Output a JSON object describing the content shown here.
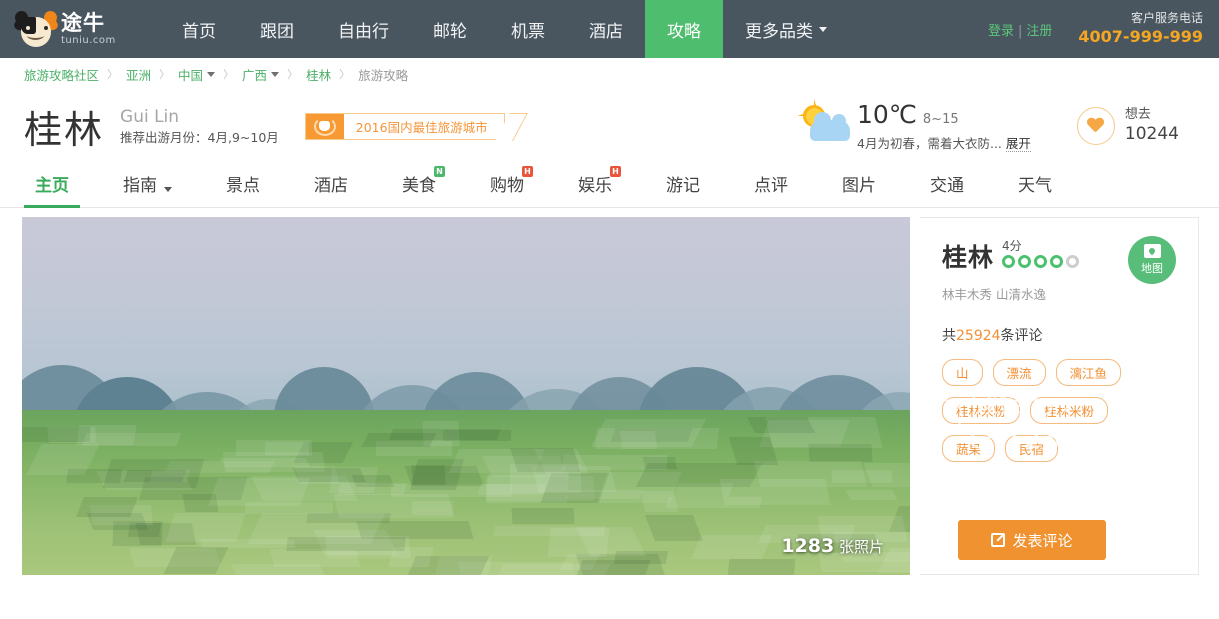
{
  "header": {
    "logo": {
      "cn": "途牛",
      "en": "tuniu.com",
      "icon": "cow-logo-icon"
    },
    "nav": [
      {
        "label": "首页",
        "active": false,
        "caret": false
      },
      {
        "label": "跟团",
        "active": false,
        "caret": false
      },
      {
        "label": "自由行",
        "active": false,
        "caret": false
      },
      {
        "label": "邮轮",
        "active": false,
        "caret": false
      },
      {
        "label": "机票",
        "active": false,
        "caret": false
      },
      {
        "label": "酒店",
        "active": false,
        "caret": false
      },
      {
        "label": "攻略",
        "active": true,
        "caret": false
      },
      {
        "label": "更多品类",
        "active": false,
        "caret": true
      }
    ],
    "login": "登录",
    "separator": "|",
    "register": "注册",
    "service_label": "客户服务电话",
    "service_phone": "4007-999-999"
  },
  "breadcrumb": {
    "items": [
      {
        "label": "旅游攻略社区",
        "caret": false,
        "current": false
      },
      {
        "label": "亚洲",
        "caret": false,
        "current": false
      },
      {
        "label": "中国",
        "caret": true,
        "current": false
      },
      {
        "label": "广西",
        "caret": true,
        "current": false
      },
      {
        "label": "桂林",
        "caret": false,
        "current": false
      },
      {
        "label": "旅游攻略",
        "caret": false,
        "current": true
      }
    ],
    "separator": "〉"
  },
  "city": {
    "name_cn": "桂林",
    "name_en": "Gui Lin",
    "best_months": "推荐出游月份：4月,9~10月",
    "award": "2016国内最佳旅游城市"
  },
  "weather": {
    "icon": "sun-cloud-icon",
    "temp": "10℃",
    "range": "8~15",
    "desc": "4月为初春，需着大衣防...",
    "expand": "展开"
  },
  "wish": {
    "icon": "heart-icon",
    "label": "想去",
    "count": "10244"
  },
  "tabs": [
    {
      "label": "主页",
      "active": true,
      "badge": "",
      "badge_type": "",
      "caret": false
    },
    {
      "label": "指南",
      "active": false,
      "badge": "",
      "badge_type": "",
      "caret": true
    },
    {
      "label": "景点",
      "active": false,
      "badge": "",
      "badge_type": "",
      "caret": false
    },
    {
      "label": "酒店",
      "active": false,
      "badge": "",
      "badge_type": "",
      "caret": false
    },
    {
      "label": "美食",
      "active": false,
      "badge": "N",
      "badge_type": "n",
      "caret": false
    },
    {
      "label": "购物",
      "active": false,
      "badge": "H",
      "badge_type": "h",
      "caret": false
    },
    {
      "label": "娱乐",
      "active": false,
      "badge": "H",
      "badge_type": "h",
      "caret": false
    },
    {
      "label": "游记",
      "active": false,
      "badge": "",
      "badge_type": "",
      "caret": false
    },
    {
      "label": "点评",
      "active": false,
      "badge": "",
      "badge_type": "",
      "caret": false
    },
    {
      "label": "图片",
      "active": false,
      "badge": "",
      "badge_type": "",
      "caret": false
    },
    {
      "label": "交通",
      "active": false,
      "badge": "",
      "badge_type": "",
      "caret": false
    },
    {
      "label": "天气",
      "active": false,
      "badge": "",
      "badge_type": "",
      "caret": false
    }
  ],
  "hero": {
    "photo_count": "1283",
    "photo_count_unit": " 张照片",
    "alt": "桂林喀斯特山峰与稻田航拍"
  },
  "sidebar": {
    "city": "桂林",
    "score": "4分",
    "dots_on": 4,
    "dots_total": 5,
    "map_button": "地图",
    "map_icon": "map-pin-icon",
    "tagline": "林丰木秀 山清水逸",
    "comment_prefix": "共",
    "comment_count": "25924",
    "comment_suffix": "条评论",
    "tags": [
      "山",
      "漂流",
      "漓江鱼",
      "桂林米粉",
      "桂林米粉",
      "蔬果",
      "民宿"
    ],
    "post_button": "发表评论",
    "post_icon": "pencil-icon"
  },
  "watermark": {
    "icon": "wechat-icon",
    "text": "微信号：cn12301"
  },
  "colors": {
    "header_bg": "#4a565f",
    "accent_green": "#4ebd6e",
    "accent_orange": "#f0922f",
    "phone_orange": "#f5a623",
    "link_green": "#4caf68",
    "badge_red": "#e8553b"
  }
}
